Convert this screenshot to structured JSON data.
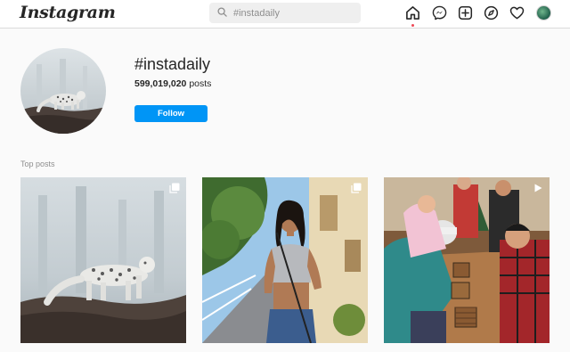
{
  "app": {
    "logo": "Instagram"
  },
  "search": {
    "placeholder": "#instadaily"
  },
  "nav": {
    "icons": [
      "home-icon",
      "messenger-icon",
      "new-post-icon",
      "explore-icon",
      "activity-heart-icon",
      "profile-avatar"
    ]
  },
  "hashtag": {
    "name": "#instadaily",
    "post_count": "599,019,020",
    "post_count_suffix": " posts",
    "follow_label": "Follow"
  },
  "section": {
    "top_posts_label": "Top posts"
  },
  "posts": [
    {
      "subject": "snow leopard on rocks",
      "badge": "multiple-photos-icon"
    },
    {
      "subject": "woman in crop top on street",
      "badge": "multiple-photos-icon"
    },
    {
      "subject": "people playing party game",
      "badge": "video-icon"
    }
  ],
  "colors": {
    "accent": "#0095f6",
    "notification_dot": "#ed4956",
    "background": "#fafafa"
  }
}
